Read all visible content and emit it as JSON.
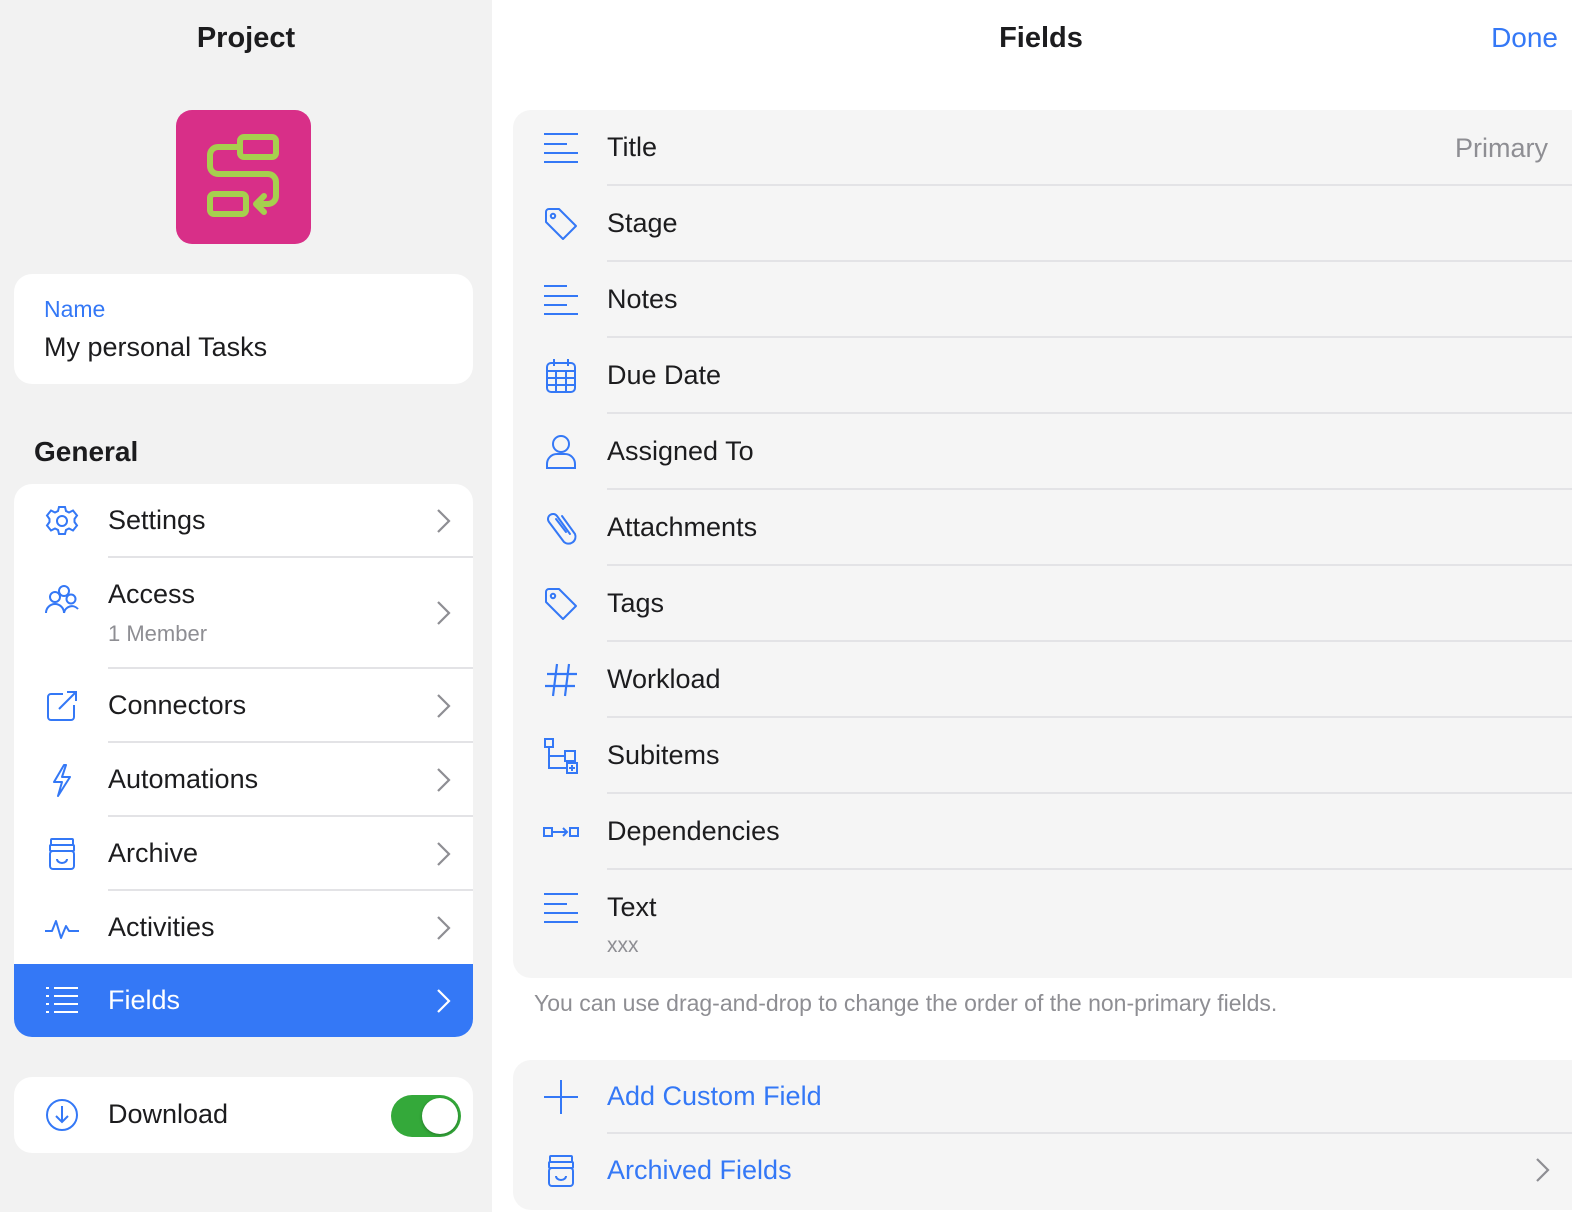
{
  "colors": {
    "accent": "#3478f6",
    "project_icon_bg": "#d82f88",
    "toggle_on": "#34a93a"
  },
  "sidebar": {
    "title": "Project",
    "project_icon": "flow-diagram-icon",
    "name": {
      "label": "Name",
      "value": "My personal Tasks"
    },
    "section_general": "General",
    "items": [
      {
        "label": "Settings",
        "icon": "gear-icon"
      },
      {
        "label": "Access",
        "sub": "1 Member",
        "icon": "people-icon"
      },
      {
        "label": "Connectors",
        "icon": "external-link-icon"
      },
      {
        "label": "Automations",
        "icon": "bolt-icon"
      },
      {
        "label": "Archive",
        "icon": "archive-box-icon"
      },
      {
        "label": "Activities",
        "icon": "activity-pulse-icon"
      },
      {
        "label": "Fields",
        "icon": "list-icon",
        "selected": true
      }
    ],
    "download": {
      "label": "Download",
      "icon": "download-circle-icon",
      "enabled": true
    }
  },
  "main": {
    "title": "Fields",
    "done_label": "Done",
    "fields": [
      {
        "label": "Title",
        "icon": "text-lines-icon",
        "badge": "Primary"
      },
      {
        "label": "Stage",
        "icon": "tag-icon"
      },
      {
        "label": "Notes",
        "icon": "text-lines-icon"
      },
      {
        "label": "Due Date",
        "icon": "calendar-icon"
      },
      {
        "label": "Assigned To",
        "icon": "person-icon"
      },
      {
        "label": "Attachments",
        "icon": "paperclip-icon"
      },
      {
        "label": "Tags",
        "icon": "tag-icon"
      },
      {
        "label": "Workload",
        "icon": "hash-icon"
      },
      {
        "label": "Subitems",
        "icon": "subitems-icon"
      },
      {
        "label": "Dependencies",
        "icon": "dependencies-icon"
      },
      {
        "label": "Text",
        "sub": "xxx",
        "icon": "text-lines-icon"
      }
    ],
    "hint": "You can use drag-and-drop to change the order of the non-primary fields.",
    "actions": [
      {
        "label": "Add Custom Field",
        "icon": "plus-icon"
      },
      {
        "label": "Archived Fields",
        "icon": "archive-box-icon"
      }
    ]
  }
}
